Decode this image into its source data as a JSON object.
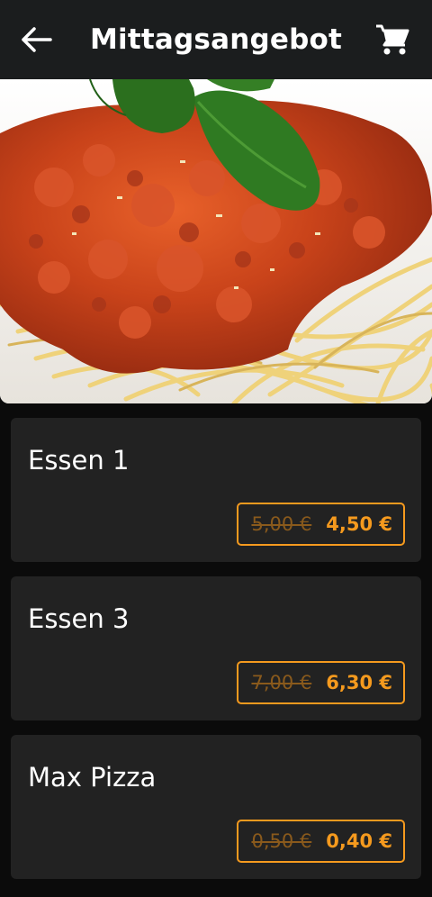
{
  "header": {
    "title": "Mittagsangebot",
    "back_icon": "arrow-left-icon",
    "cart_icon": "shopping-cart-icon"
  },
  "hero": {
    "image": "spaghetti-bolognese-photo"
  },
  "items": [
    {
      "name": "Essen 1",
      "old_price": "5,00 €",
      "new_price": "4,50 €"
    },
    {
      "name": "Essen 3",
      "old_price": "7,00 €",
      "new_price": "6,30 €"
    },
    {
      "name": "Max Pizza",
      "old_price": "0,50 €",
      "new_price": "0,40 €"
    }
  ],
  "colors": {
    "accent": "#f59a1e",
    "card": "#222222",
    "appbar": "#1b1d1e",
    "background": "#0b0b0b"
  }
}
